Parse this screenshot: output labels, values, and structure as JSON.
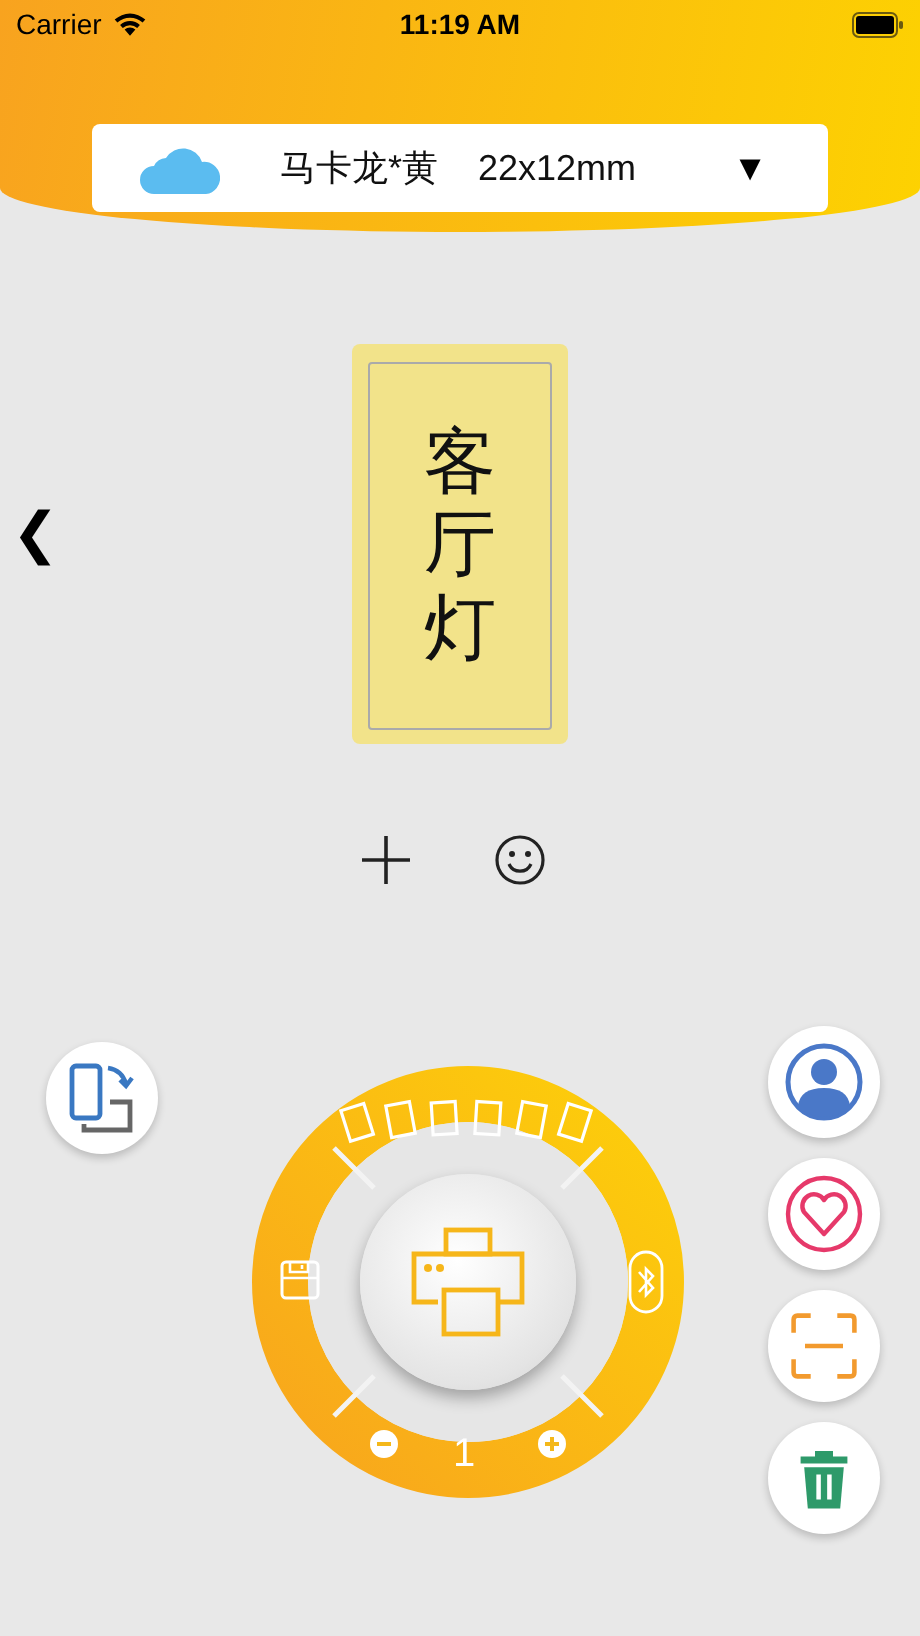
{
  "status_bar": {
    "carrier": "Carrier",
    "time": "11:19 AM"
  },
  "label_selector": {
    "name": "马卡龙*黄",
    "size": "22x12mm",
    "dropdown": "▼"
  },
  "back": "❮",
  "label": {
    "text": "客厅灯"
  },
  "dial": {
    "copies": "1"
  }
}
